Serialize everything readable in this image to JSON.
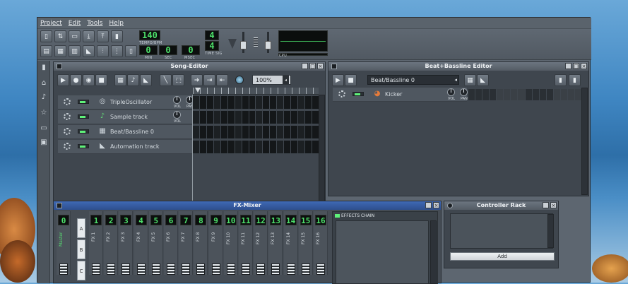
{
  "menu": [
    "Project",
    "Edit",
    "Tools",
    "Help"
  ],
  "toolbar": {
    "tempo_value": "140",
    "tempo_label": "TEMPO/BPM",
    "min_value": "0",
    "sec_value": "0",
    "msec_value": "0",
    "min_label": "MIN",
    "sec_label": "SEC",
    "msec_label": "MSEC",
    "timesig_top": "4",
    "timesig_bottom": "4",
    "timesig_label": "TIME SIG",
    "cpu_label": "CPU"
  },
  "song_editor": {
    "title": "Song-Editor",
    "zoom": "100%",
    "tracks": [
      {
        "name": "TripleOscillator",
        "icon": "oscillator-icon"
      },
      {
        "name": "Sample track",
        "icon": "note-icon"
      },
      {
        "name": "Beat/Bassline 0",
        "icon": "beat-bassline-icon"
      },
      {
        "name": "Automation track",
        "icon": "automation-icon"
      }
    ],
    "vol_label": "VOL",
    "pan_label": "PAN"
  },
  "bb_editor": {
    "title": "Beat+Bassline Editor",
    "selector_value": "Beat/Bassline 0",
    "track_name": "Kicker",
    "vol_label": "VOL",
    "pan_label": "PAN"
  },
  "fx_mixer": {
    "title": "FX-Mixer",
    "master_label": "Master",
    "master_num": "0",
    "channels": [
      {
        "num": "1",
        "label": "FX 1"
      },
      {
        "num": "2",
        "label": "FX 2"
      },
      {
        "num": "3",
        "label": "FX 3"
      },
      {
        "num": "4",
        "label": "FX 4"
      },
      {
        "num": "5",
        "label": "FX 5"
      },
      {
        "num": "6",
        "label": "FX 6"
      },
      {
        "num": "7",
        "label": "FX 7"
      },
      {
        "num": "8",
        "label": "FX 8"
      },
      {
        "num": "9",
        "label": "FX 9"
      },
      {
        "num": "10",
        "label": "FX 10"
      },
      {
        "num": "11",
        "label": "FX 11"
      },
      {
        "num": "12",
        "label": "FX 12"
      },
      {
        "num": "13",
        "label": "FX 13"
      },
      {
        "num": "14",
        "label": "FX 14"
      },
      {
        "num": "15",
        "label": "FX 15"
      },
      {
        "num": "16",
        "label": "FX 16"
      }
    ],
    "banks": [
      "A",
      "B",
      "C"
    ],
    "effects_chain_label": "EFFECTS CHAIN"
  },
  "controller_rack": {
    "title": "Controller Rack",
    "add_label": "Add"
  },
  "colors": {
    "lcd_green": "#4de06a",
    "panel": "#3f464e",
    "titlebar": "#5f6872"
  }
}
